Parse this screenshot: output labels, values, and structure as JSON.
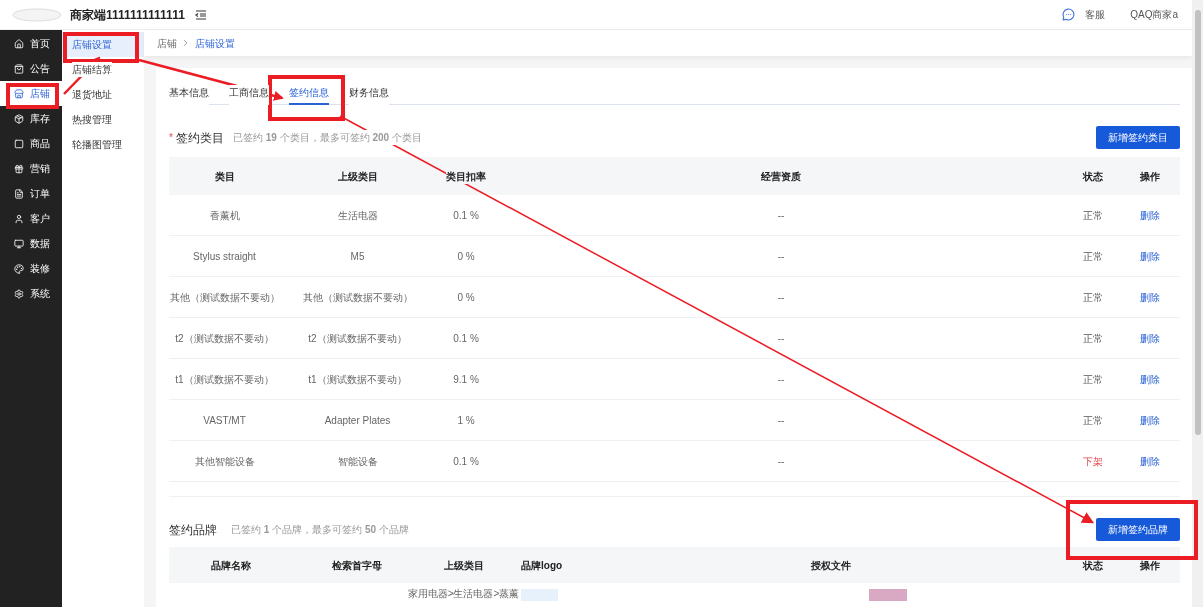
{
  "header": {
    "title": "商家端1111111111111",
    "service_label": "客服",
    "account": "QAQ商家a"
  },
  "sidebar": {
    "items": [
      {
        "label": "首页",
        "selected": false
      },
      {
        "label": "公告",
        "selected": false
      },
      {
        "label": "店铺",
        "selected": true
      },
      {
        "label": "库存",
        "selected": false
      },
      {
        "label": "商品",
        "selected": false
      },
      {
        "label": "营销",
        "selected": false
      },
      {
        "label": "订单",
        "selected": false
      },
      {
        "label": "客户",
        "selected": false
      },
      {
        "label": "数据",
        "selected": false
      },
      {
        "label": "装修",
        "selected": false
      },
      {
        "label": "系统",
        "selected": false
      }
    ]
  },
  "submenu": {
    "items": [
      {
        "label": "店铺设置",
        "selected": true
      },
      {
        "label": "店铺结算",
        "selected": false
      },
      {
        "label": "退货地址",
        "selected": false
      },
      {
        "label": "热搜管理",
        "selected": false
      },
      {
        "label": "轮播图管理",
        "selected": false
      }
    ]
  },
  "breadcrumb": [
    {
      "label": "店铺",
      "current": false
    },
    {
      "label": "店铺设置",
      "current": true
    }
  ],
  "tabs": [
    {
      "label": "基本信息",
      "selected": false
    },
    {
      "label": "工商信息",
      "selected": false
    },
    {
      "label": "签约信息",
      "selected": true
    },
    {
      "label": "财务信息",
      "selected": false
    }
  ],
  "category_section": {
    "required_mark": "*",
    "title": "签约类目",
    "summary": "已签约 **19** 个类目，最多可签约 **200** 个类目",
    "add_button": "新增签约类目",
    "columns": [
      "类目",
      "上级类目",
      "类目扣率",
      "经营资质",
      "状态",
      "操作"
    ],
    "rows": [
      {
        "category": "香薰机",
        "parent": "生活电器",
        "rate": "0.1 %",
        "qualification": "--",
        "status": "正常",
        "delisted": false,
        "action": "删除"
      },
      {
        "category": "Stylus straight",
        "parent": "M5",
        "rate": "0 %",
        "qualification": "--",
        "status": "正常",
        "delisted": false,
        "action": "删除"
      },
      {
        "category": "其他（测试数据不要动）",
        "parent": "其他（测试数据不要动）",
        "rate": "0 %",
        "qualification": "--",
        "status": "正常",
        "delisted": false,
        "action": "删除"
      },
      {
        "category": "t2（测试数据不要动）",
        "parent": "t2（测试数据不要动）",
        "rate": "0.1 %",
        "qualification": "--",
        "status": "正常",
        "delisted": false,
        "action": "删除"
      },
      {
        "category": "t1（测试数据不要动）",
        "parent": "t1（测试数据不要动）",
        "rate": "9.1 %",
        "qualification": "--",
        "status": "正常",
        "delisted": false,
        "action": "删除"
      },
      {
        "category": "VAST/MT",
        "parent": "Adapter Plates",
        "rate": "1 %",
        "qualification": "--",
        "status": "正常",
        "delisted": false,
        "action": "删除"
      },
      {
        "category": "其他智能设备",
        "parent": "智能设备",
        "rate": "0.1 %",
        "qualification": "--",
        "status": "下架",
        "delisted": true,
        "action": "删除"
      }
    ]
  },
  "brand_section": {
    "title": "签约品牌",
    "summary": "已签约 **1** 个品牌，最多可签约 **50** 个品牌",
    "add_button": "新增签约品牌",
    "columns": [
      "品牌名称",
      "检索首字母",
      "上级类目",
      "品牌logo",
      "授权文件",
      "状态",
      "操作"
    ],
    "rows": [
      {
        "parent": "家用电器>生活电器>蒸薰"
      }
    ]
  }
}
